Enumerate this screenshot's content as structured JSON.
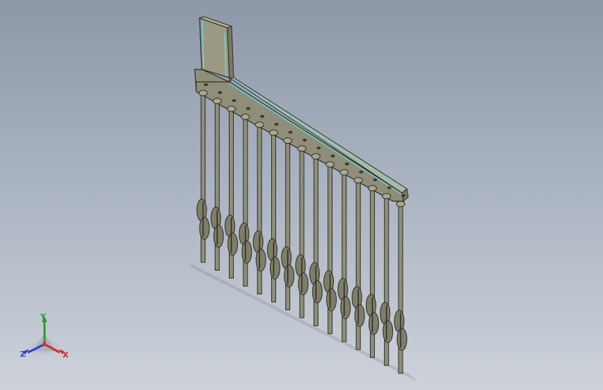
{
  "viewport": {
    "background_top": "#8d97a8",
    "background_bottom": "#cdd2da"
  },
  "model": {
    "description_icon": "comb-terminal-part",
    "body_color": "#8f8e78",
    "edge_color": "#2b2b22",
    "highlight_color": "#5fd6e6",
    "pin_count": 15
  },
  "triad": {
    "x_label": "X",
    "y_label": "Y",
    "z_label": "Z",
    "x_color": "#cf2a2a",
    "y_color": "#2a9a2a",
    "z_color": "#2a3fcf"
  }
}
